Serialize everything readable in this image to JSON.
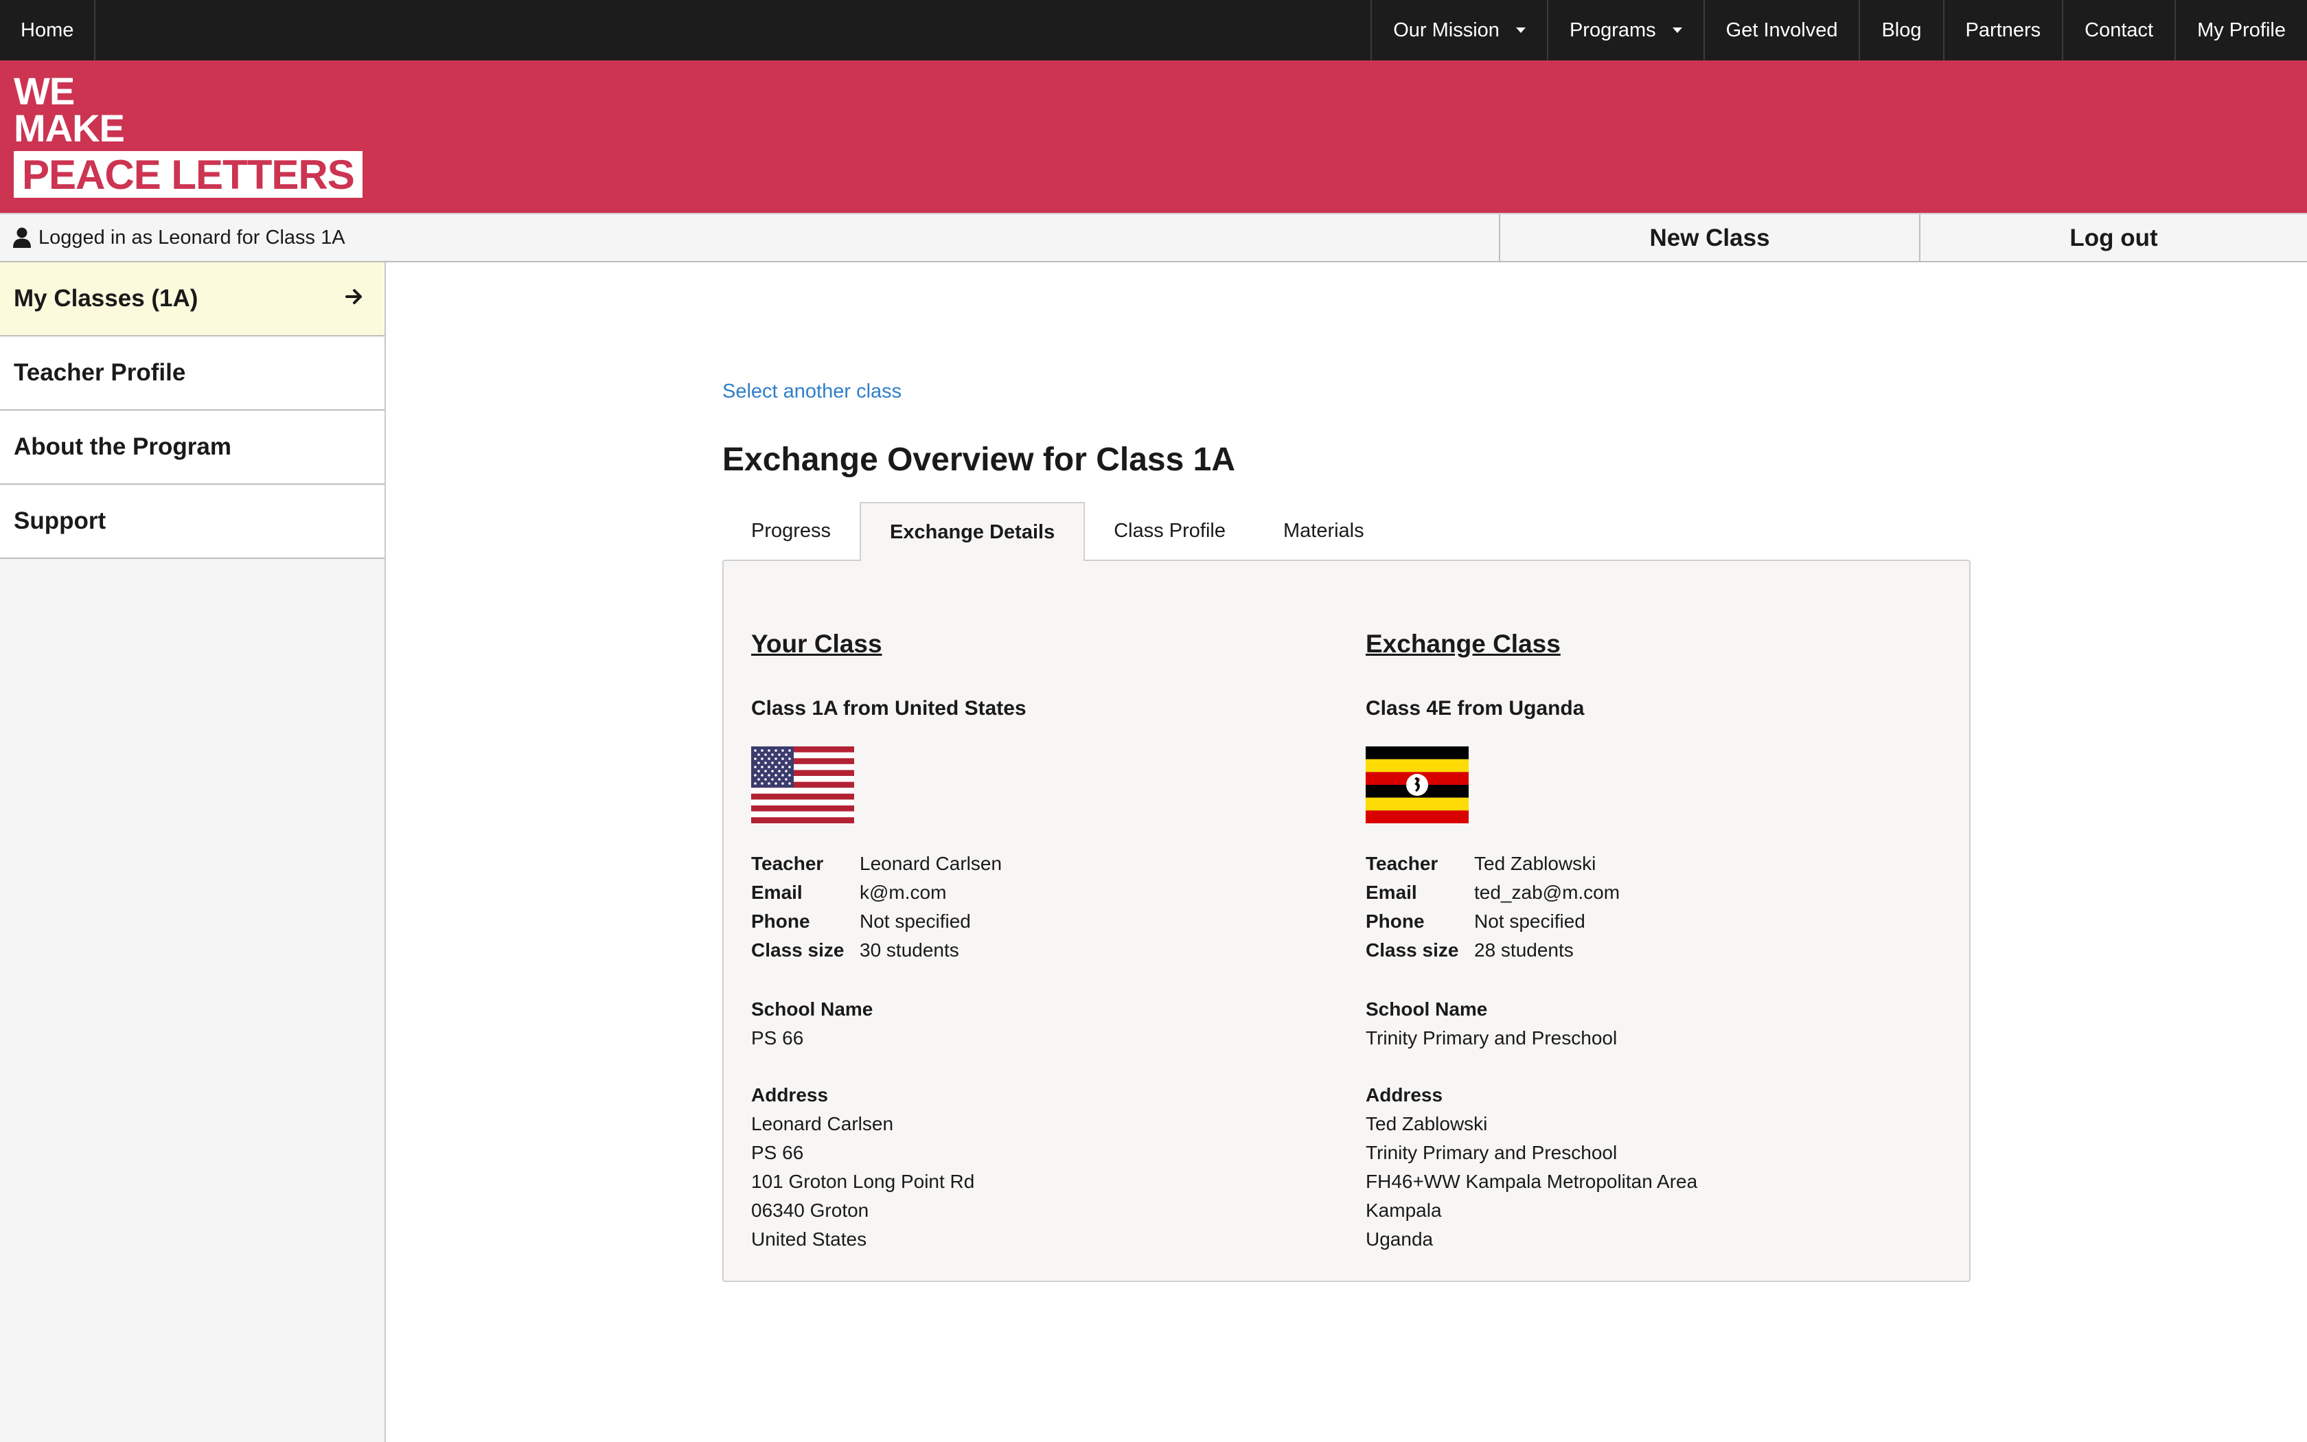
{
  "topnav": {
    "home": "Home",
    "items": [
      "Our Mission",
      "Programs",
      "Get Involved",
      "Blog",
      "Partners",
      "Contact",
      "My Profile"
    ]
  },
  "brand": {
    "line1": "WE",
    "line2": "MAKE",
    "line3": "PEACE LETTERS",
    "color": "#cc3452"
  },
  "status": {
    "logged_in": "Logged in as Leonard for Class 1A",
    "new_class": "New Class",
    "logout": "Log out"
  },
  "sidebar": {
    "items": [
      {
        "label": "My Classes (1A)",
        "active": true
      },
      {
        "label": "Teacher Profile"
      },
      {
        "label": "About the Program"
      },
      {
        "label": "Support"
      }
    ]
  },
  "main": {
    "select_link": "Select another class",
    "title": "Exchange Overview for Class 1A",
    "tabs": [
      "Progress",
      "Exchange Details",
      "Class Profile",
      "Materials"
    ],
    "active_tab": "Exchange Details"
  },
  "labels": {
    "teacher": "Teacher",
    "email": "Email",
    "phone": "Phone",
    "class_size": "Class size",
    "school_name": "School Name",
    "address": "Address"
  },
  "your_class": {
    "heading": "Your Class",
    "subtitle": "Class 1A from United States",
    "flag": "united-states-flag",
    "teacher": "Leonard Carlsen",
    "email": "k@m.com",
    "phone": "Not specified",
    "class_size": "30 students",
    "school_name": "PS 66",
    "address": [
      "Leonard Carlsen",
      "PS 66",
      "101 Groton Long Point Rd",
      "06340 Groton",
      "United States"
    ]
  },
  "exchange_class": {
    "heading": "Exchange Class",
    "subtitle": "Class 4E from Uganda",
    "flag": "uganda-flag",
    "teacher": "Ted Zablowski",
    "email": "ted_zab@m.com",
    "phone": "Not specified",
    "class_size": "28 students",
    "school_name": "Trinity Primary and Preschool",
    "address": [
      "Ted Zablowski",
      "Trinity Primary and Preschool",
      "FH46+WW Kampala Metropolitan Area",
      "Kampala",
      "Uganda"
    ]
  }
}
